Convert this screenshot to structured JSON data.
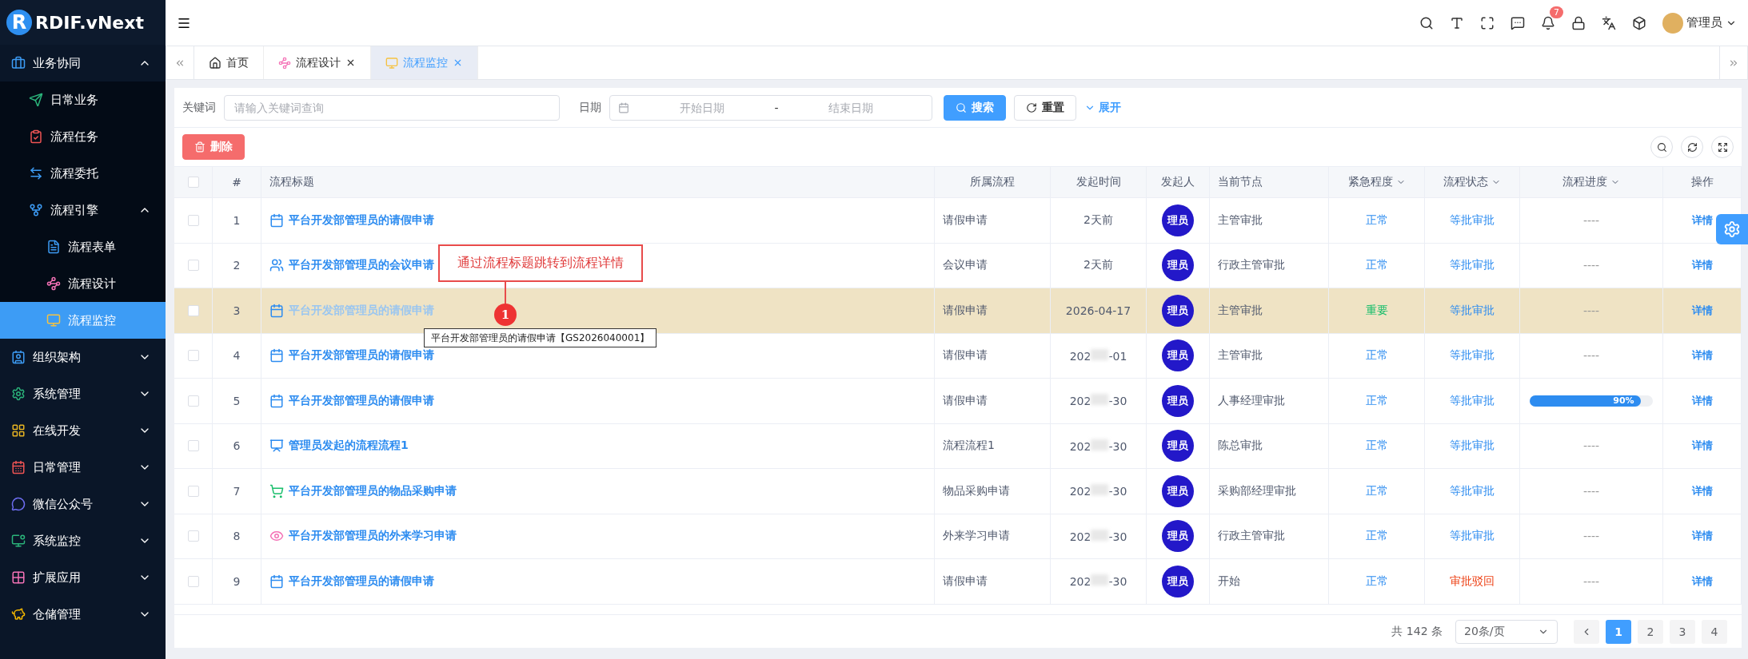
{
  "logo": {
    "mark": "R",
    "text": "RDIF.vNext"
  },
  "sidebar": {
    "items": [
      {
        "label": "业务协同",
        "expanded": true,
        "selected": false,
        "children": [
          {
            "label": "日常业务",
            "selected": false
          },
          {
            "label": "流程任务",
            "selected": false
          },
          {
            "label": "流程委托",
            "selected": false
          },
          {
            "label": "流程引擎",
            "expanded": true,
            "selected": false,
            "children": [
              {
                "label": "流程表单",
                "selected": false
              },
              {
                "label": "流程设计",
                "selected": false
              },
              {
                "label": "流程监控",
                "selected": true
              }
            ]
          }
        ]
      },
      {
        "label": "组织架构",
        "expanded": false,
        "selected": false
      },
      {
        "label": "系统管理",
        "expanded": false,
        "selected": false
      },
      {
        "label": "在线开发",
        "expanded": false,
        "selected": false
      },
      {
        "label": "日常管理",
        "expanded": false,
        "selected": false
      },
      {
        "label": "微信公众号",
        "expanded": false,
        "selected": false
      },
      {
        "label": "系统监控",
        "expanded": false,
        "selected": false
      },
      {
        "label": "扩展应用",
        "expanded": false,
        "selected": false
      },
      {
        "label": "仓储管理",
        "expanded": false,
        "selected": false
      }
    ]
  },
  "header": {
    "notification_count": "7",
    "user": "管理员"
  },
  "tabs": [
    {
      "label": "首页",
      "selected": false,
      "closable": false
    },
    {
      "label": "流程设计",
      "selected": false,
      "closable": true
    },
    {
      "label": "流程监控",
      "selected": true,
      "closable": true
    }
  ],
  "filters": {
    "keyword_label": "关键词",
    "keyword_placeholder": "请输入关键词查询",
    "date_label": "日期",
    "start_placeholder": "开始日期",
    "range_separator": "-",
    "end_placeholder": "结束日期",
    "search_button": "搜索",
    "reset_button": "重置",
    "expand_link": "展开"
  },
  "toolbar": {
    "delete_button": "删除"
  },
  "table": {
    "select_all_checked": false,
    "columns": [
      {
        "label": "#",
        "sortable": false
      },
      {
        "label": "流程标题",
        "sortable": false
      },
      {
        "label": "所属流程",
        "sortable": false
      },
      {
        "label": "发起时间",
        "sortable": false
      },
      {
        "label": "发起人",
        "sortable": false
      },
      {
        "label": "当前节点",
        "sortable": false
      },
      {
        "label": "紧急程度",
        "sortable": true
      },
      {
        "label": "流程状态",
        "sortable": true
      },
      {
        "label": "流程进度",
        "sortable": true
      },
      {
        "label": "操作",
        "sortable": false
      }
    ],
    "rows": [
      {
        "index": "1",
        "kind": "leave",
        "title": "平台开发部管理员的请假申请",
        "process": "请假申请",
        "time": "2天前",
        "blurred": false,
        "initiator": "理员",
        "node": "主管审批",
        "urgency": {
          "text": "正常",
          "kind": "normal"
        },
        "status": {
          "text": "等批审批",
          "kind": "pending"
        },
        "progress": {
          "empty": "----"
        },
        "action": "详情",
        "selected": false,
        "checked": false
      },
      {
        "index": "2",
        "kind": "meeting",
        "title": "平台开发部管理员的会议申请",
        "process": "会议申请",
        "time": "2天前",
        "blurred": false,
        "initiator": "理员",
        "node": "行政主管审批",
        "urgency": {
          "text": "正常",
          "kind": "normal"
        },
        "status": {
          "text": "等批审批",
          "kind": "pending"
        },
        "progress": {
          "empty": "----"
        },
        "action": "详情",
        "selected": false,
        "checked": false
      },
      {
        "index": "3",
        "kind": "leave",
        "title": "平台开发部管理员的请假申请",
        "process": "请假申请",
        "time": "2026-04-17",
        "blurred": false,
        "initiator": "理员",
        "node": "主管审批",
        "urgency": {
          "text": "重要",
          "kind": "important"
        },
        "status": {
          "text": "等批审批",
          "kind": "pending"
        },
        "progress": {
          "empty": "----"
        },
        "action": "详情",
        "selected": true,
        "checked": false
      },
      {
        "index": "4",
        "kind": "leave",
        "title": "平台开发部管理员的请假申请",
        "process": "请假申请",
        "time": "202",
        "time_end": "-01",
        "blurred": true,
        "initiator": "理员",
        "node": "主管审批",
        "urgency": {
          "text": "正常",
          "kind": "normal"
        },
        "status": {
          "text": "等批审批",
          "kind": "pending"
        },
        "progress": {
          "empty": "----"
        },
        "action": "详情",
        "selected": false,
        "checked": false
      },
      {
        "index": "5",
        "kind": "leave",
        "title": "平台开发部管理员的请假申请",
        "process": "请假申请",
        "time": "202",
        "time_end": "-30",
        "blurred": true,
        "initiator": "理员",
        "node": "人事经理审批",
        "urgency": {
          "text": "正常",
          "kind": "normal"
        },
        "status": {
          "text": "等批审批",
          "kind": "pending"
        },
        "progress": {
          "level": 0.9,
          "label": "90%"
        },
        "action": "详情",
        "selected": false,
        "checked": false
      },
      {
        "index": "6",
        "kind": "flow",
        "title": "管理员发起的流程流程1",
        "process": "流程流程1",
        "time": "202",
        "time_end": "-30",
        "blurred": true,
        "initiator": "理员",
        "node": "陈总审批",
        "urgency": {
          "text": "正常",
          "kind": "normal"
        },
        "status": {
          "text": "等批审批",
          "kind": "pending"
        },
        "progress": {
          "empty": "----"
        },
        "action": "详情",
        "selected": false,
        "checked": false
      },
      {
        "index": "7",
        "kind": "purchase",
        "title": "平台开发部管理员的物品采购申请",
        "process": "物品采购申请",
        "time": "202",
        "time_end": "-30",
        "blurred": true,
        "initiator": "理员",
        "node": "采购部经理审批",
        "urgency": {
          "text": "正常",
          "kind": "normal"
        },
        "status": {
          "text": "等批审批",
          "kind": "pending"
        },
        "progress": {
          "empty": "----"
        },
        "action": "详情",
        "selected": false,
        "checked": false
      },
      {
        "index": "8",
        "kind": "study",
        "title": "平台开发部管理员的外来学习申请",
        "process": "外来学习申请",
        "time": "202",
        "time_end": "-30",
        "blurred": true,
        "initiator": "理员",
        "node": "行政主管审批",
        "urgency": {
          "text": "正常",
          "kind": "normal"
        },
        "status": {
          "text": "等批审批",
          "kind": "pending"
        },
        "progress": {
          "empty": "----"
        },
        "action": "详情",
        "selected": false,
        "checked": false
      },
      {
        "index": "9",
        "kind": "leave",
        "title": "平台开发部管理员的请假申请",
        "process": "请假申请",
        "time": "202",
        "time_end": "-30",
        "blurred": true,
        "initiator": "理员",
        "node": "开始",
        "urgency": {
          "text": "正常",
          "kind": "normal"
        },
        "status": {
          "text": "审批驳回",
          "kind": "rejected"
        },
        "progress": {
          "empty": "----"
        },
        "action": "详情",
        "selected": false,
        "checked": false
      }
    ]
  },
  "annotation": {
    "text": "通过流程标题跳转到流程详情",
    "marker": "1",
    "tooltip": "平台开发部管理员的请假申请【GS2026040001】"
  },
  "pagination": {
    "total": "共 142 条",
    "page_size": "20条/页",
    "pages": [
      {
        "label": "1",
        "selected": true
      },
      {
        "label": "2",
        "selected": false
      },
      {
        "label": "3",
        "selected": false
      },
      {
        "label": "4",
        "selected": false
      }
    ]
  }
}
